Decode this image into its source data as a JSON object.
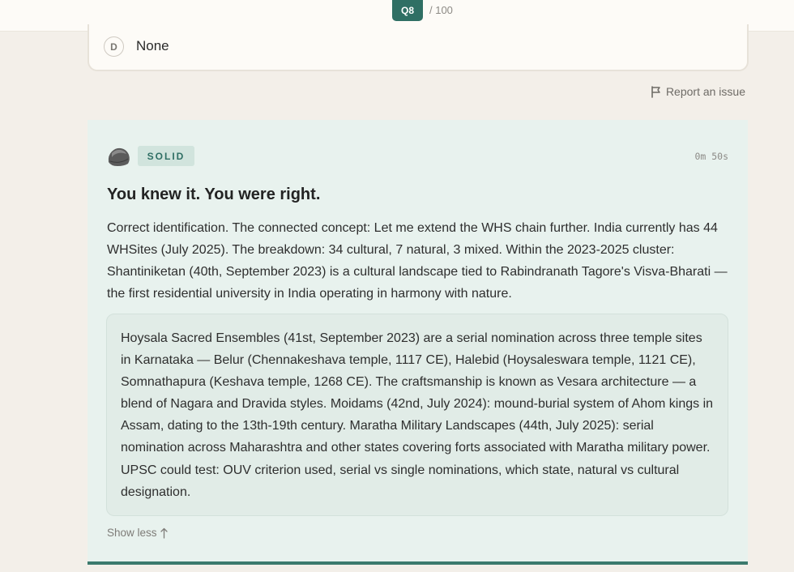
{
  "header": {
    "question_badge": "Q8",
    "question_total": "/ 100"
  },
  "option": {
    "letter": "D",
    "text": "None"
  },
  "report_link": "Report an issue",
  "feedback": {
    "confidence_badge": "SOLID",
    "timer": "0m 50s",
    "headline": "You knew it. You were right.",
    "explanation": "Correct identification. The connected concept: Let me extend the WHS chain further. India currently has 44 WHSites (July 2025). The breakdown: 34 cultural, 7 natural, 3 mixed. Within the 2023-2025 cluster: Shantiniketan (40th, September 2023) is a cultural landscape tied to Rabindranath Tagore's Visva-Bharati — the first residential university in India operating in harmony with nature.",
    "detail": "Hoysala Sacred Ensembles (41st, September 2023) are a serial nomination across three temple sites in Karnataka — Belur (Chennakeshava temple, 1117 CE), Halebid (Hoysaleswara temple, 1121 CE), Somnathapura (Keshava temple, 1268 CE). The craftsmanship is known as Vesara architecture — a blend of Nagara and Dravida styles. Moidams (42nd, July 2024): mound-burial system of Ahom kings in Assam, dating to the 13th-19th century. Maratha Military Landscapes (44th, July 2025): serial nomination across Maharashtra and other states covering forts associated with Maratha military power. UPSC could test: OUV criterion used, serial vs single nominations, which state, natural vs cultural designation.",
    "show_less_label": "Show less"
  },
  "icons": {
    "report": "flag-icon",
    "confidence": "rock-icon",
    "show_less": "arrow-up-icon"
  },
  "colors": {
    "accent": "#2f6f64",
    "feedback_bg": "#e8f2ee",
    "page_bg": "#f3efe9"
  }
}
